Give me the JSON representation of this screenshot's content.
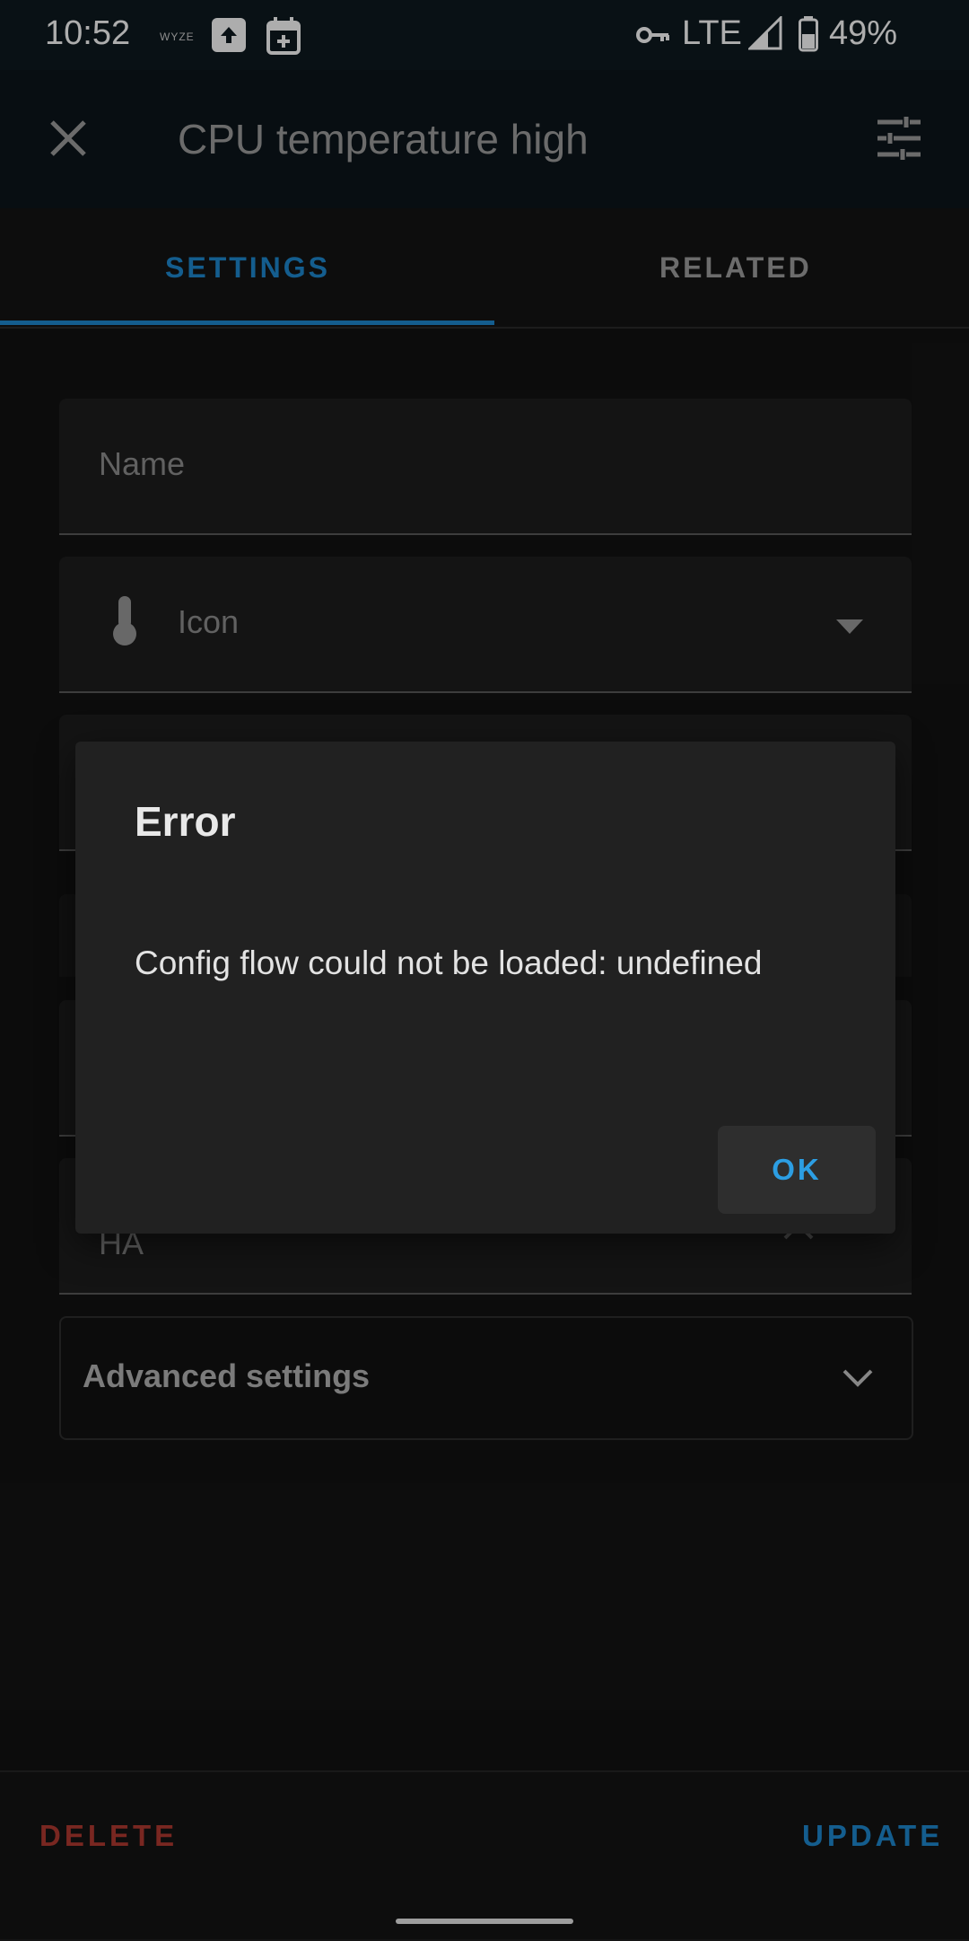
{
  "status_bar": {
    "time": "10:52",
    "notification_icons": [
      "wyze-icon",
      "upload-icon",
      "calendar-add-icon"
    ],
    "wyze_text": "WYZE",
    "network": "LTE",
    "battery": "49%"
  },
  "app_bar": {
    "title": "CPU temperature high",
    "close_icon": "close-icon",
    "settings_icon": "tune-icon"
  },
  "tabs": [
    {
      "label": "SETTINGS",
      "active": true
    },
    {
      "label": "RELATED",
      "active": false
    }
  ],
  "form": {
    "name_label": "Name",
    "icon_label": "Icon",
    "area_value": "HA",
    "advanced_label": "Advanced settings"
  },
  "dialog": {
    "title": "Error",
    "message": "Config flow could not be loaded: undefined",
    "ok_label": "OK"
  },
  "bottom": {
    "delete_label": "DELETE",
    "update_label": "UPDATE"
  },
  "colors": {
    "accent": "#1e8ad1",
    "danger": "#b33a32",
    "background": "#131313",
    "dialog": "#212121"
  }
}
